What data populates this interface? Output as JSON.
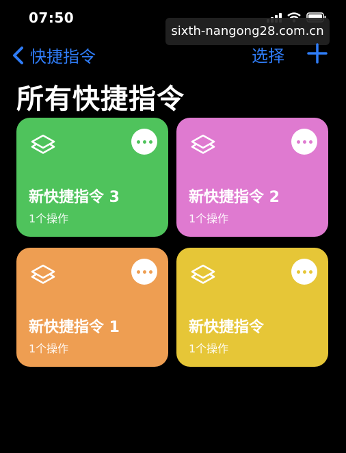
{
  "status": {
    "time": "07:50",
    "icons": [
      "signal-icon",
      "wifi-icon",
      "battery-icon"
    ]
  },
  "watermark": {
    "text": "sixth-nangong28.com.cn"
  },
  "nav": {
    "back_label": "快捷指令",
    "select_label": "选择",
    "accent_color": "#2f7cf6"
  },
  "title": "所有快捷指令",
  "shortcuts": [
    {
      "name": "新快捷指令 3",
      "actions": "1个操作",
      "color": "#4fc35c"
    },
    {
      "name": "新快捷指令 2",
      "actions": "1个操作",
      "color": "#df7ad0"
    },
    {
      "name": "新快捷指令 1",
      "actions": "1个操作",
      "color": "#ee9e52"
    },
    {
      "name": "新快捷指令",
      "actions": "1个操作",
      "color": "#e6c637"
    }
  ]
}
